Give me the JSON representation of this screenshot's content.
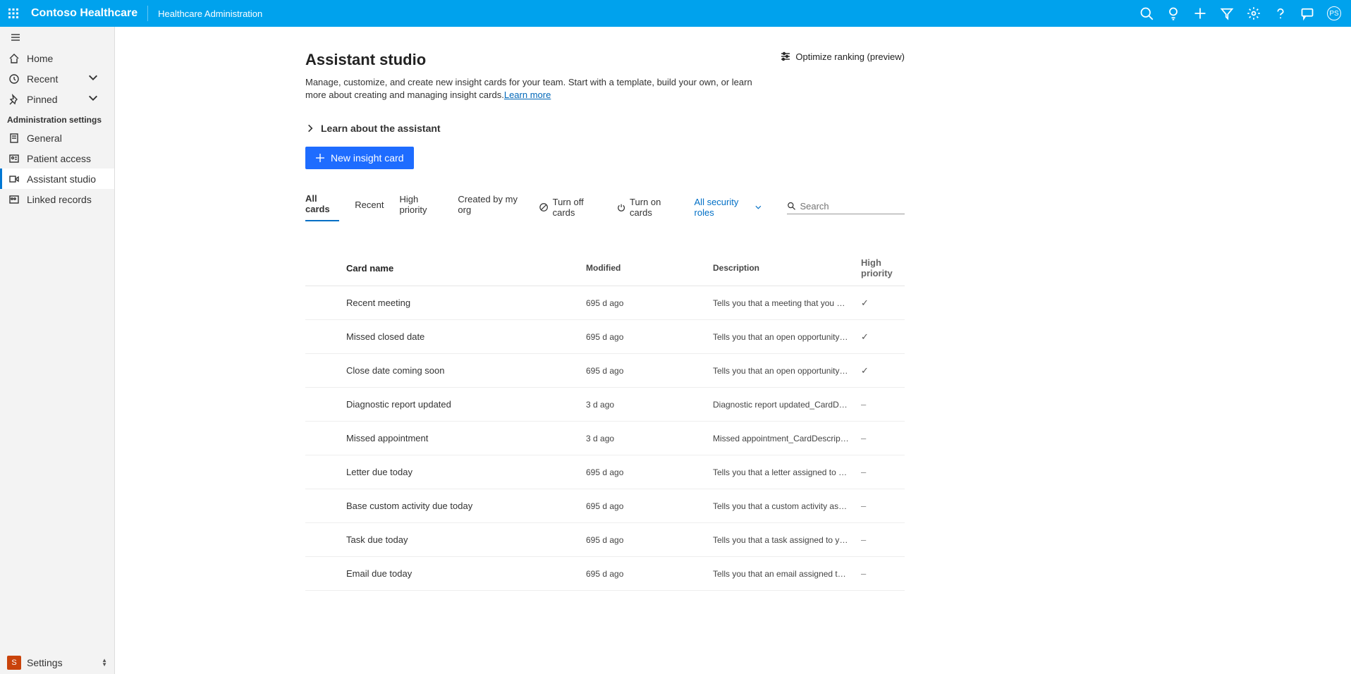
{
  "header": {
    "brand": "Contoso Healthcare",
    "sub": "Healthcare Administration",
    "avatar": "PS"
  },
  "sidebar": {
    "home": "Home",
    "recent": "Recent",
    "pinned": "Pinned",
    "group": "Administration settings",
    "general": "General",
    "patient": "Patient access",
    "assistant": "Assistant studio",
    "linked": "Linked records",
    "settings": "Settings"
  },
  "page": {
    "title": "Assistant studio",
    "desc_a": "Manage, customize, and create new insight cards for your team. Start with a template, build your own, or learn more about creating and managing insight cards.",
    "learn_more": "Learn more",
    "learn_about": "Learn about the assistant",
    "new_card": "New insight card",
    "optimize": "Optimize ranking (preview)"
  },
  "toolbar": {
    "all": "All cards",
    "recent": "Recent",
    "high": "High priority",
    "created": "Created by my org",
    "off": "Turn off cards",
    "on": "Turn on cards",
    "role": "All security roles",
    "search_ph": "Search"
  },
  "table": {
    "headers": {
      "name": "Card name",
      "modified": "Modified",
      "desc": "Description",
      "hp": "High priority"
    },
    "rows": [
      {
        "name": "Recent meeting",
        "modified": "695 d ago",
        "desc": "Tells you that a meeting that you organize…",
        "hp": "yes"
      },
      {
        "name": "Missed closed date",
        "modified": "695 d ago",
        "desc": "Tells you that an open opportunity has pa…",
        "hp": "yes"
      },
      {
        "name": "Close date coming soon",
        "modified": "695 d ago",
        "desc": "Tells you that an open opportunity will so…",
        "hp": "yes"
      },
      {
        "name": "Diagnostic report updated",
        "modified": "3 d ago",
        "desc": "Diagnostic report updated_CardDescription",
        "hp": "no"
      },
      {
        "name": "Missed appointment",
        "modified": "3 d ago",
        "desc": "Missed appointment_CardDescription",
        "hp": "no"
      },
      {
        "name": "Letter due today",
        "modified": "695 d ago",
        "desc": "Tells you that a letter assigned to you is d…",
        "hp": "no"
      },
      {
        "name": "Base custom activity due today",
        "modified": "695 d ago",
        "desc": "Tells you that a custom activity assigned t…",
        "hp": "no"
      },
      {
        "name": "Task due today",
        "modified": "695 d ago",
        "desc": "Tells you that a task assigned to you is du…",
        "hp": "no"
      },
      {
        "name": "Email due today",
        "modified": "695 d ago",
        "desc": "Tells you that an email assigned to you is …",
        "hp": "no"
      }
    ]
  }
}
